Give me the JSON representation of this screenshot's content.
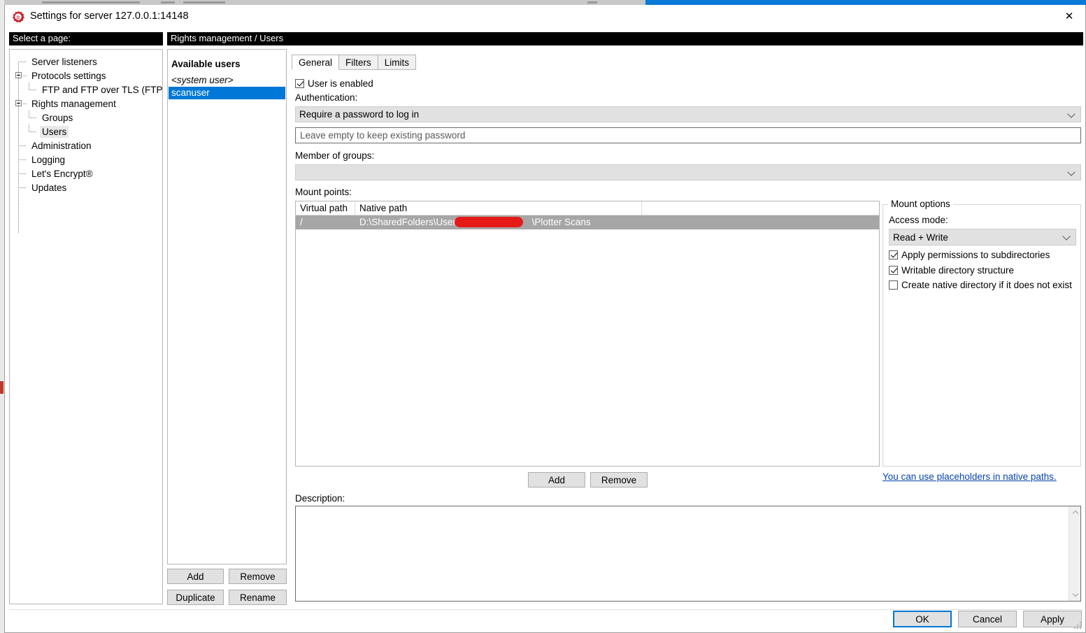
{
  "window": {
    "title": "Settings for server 127.0.0.1:14148",
    "icon": "filezilla-icon",
    "close_label": "✕"
  },
  "left_header": "Select a page:",
  "right_header": "Rights management / Users",
  "tree": {
    "items": [
      {
        "label": "Server listeners",
        "level": 1,
        "expander": false,
        "selected": false
      },
      {
        "label": "Protocols settings",
        "level": 1,
        "expander": true,
        "selected": false
      },
      {
        "label": "FTP and FTP over TLS (FTPS)",
        "level": 2,
        "expander": false,
        "selected": false
      },
      {
        "label": "Rights management",
        "level": 1,
        "expander": true,
        "selected": false
      },
      {
        "label": "Groups",
        "level": 2,
        "expander": false,
        "selected": false
      },
      {
        "label": "Users",
        "level": 2,
        "expander": false,
        "selected": true
      },
      {
        "label": "Administration",
        "level": 1,
        "expander": false,
        "selected": false
      },
      {
        "label": "Logging",
        "level": 1,
        "expander": false,
        "selected": false
      },
      {
        "label": "Let's Encrypt®",
        "level": 1,
        "expander": false,
        "selected": false
      },
      {
        "label": "Updates",
        "level": 1,
        "expander": false,
        "selected": false
      }
    ]
  },
  "users_panel": {
    "title": "Available users",
    "items": [
      {
        "label": "<system user>",
        "system": true,
        "selected": false
      },
      {
        "label": "scanuser",
        "system": false,
        "selected": true
      }
    ],
    "buttons": {
      "add": "Add",
      "remove": "Remove",
      "duplicate": "Duplicate",
      "rename": "Rename"
    }
  },
  "tabs": [
    {
      "label": "General",
      "active": true
    },
    {
      "label": "Filters",
      "active": false
    },
    {
      "label": "Limits",
      "active": false
    }
  ],
  "general": {
    "user_enabled_label": "User is enabled",
    "user_enabled_checked": true,
    "authentication_label": "Authentication:",
    "authentication_value": "Require a password to log in",
    "password_placeholder": "Leave empty to keep existing password",
    "member_of_groups_label": "Member of groups:",
    "member_of_groups_value": "",
    "mount_points_label": "Mount points:",
    "mount_points": {
      "columns": [
        "Virtual path",
        "Native path"
      ],
      "rows": [
        {
          "virtual_path": "/",
          "native_path_prefix": "D:\\SharedFolders\\Users\\",
          "native_path_suffix": "\\Plotter Scans",
          "redacted": true,
          "selected": true
        }
      ]
    },
    "add_label": "Add",
    "remove_label": "Remove",
    "placeholder_link": "You can use placeholders in native paths.",
    "description_label": "Description:",
    "description_value": ""
  },
  "mount_options": {
    "group_title": "Mount options",
    "access_mode_label": "Access mode:",
    "access_mode_value": "Read + Write",
    "checkboxes": [
      {
        "label": "Apply permissions to subdirectories",
        "checked": true
      },
      {
        "label": "Writable directory structure",
        "checked": true
      },
      {
        "label": "Create native directory if it does not exist",
        "checked": false
      }
    ]
  },
  "footer": {
    "ok": "OK",
    "cancel": "Cancel",
    "apply": "Apply"
  },
  "colors": {
    "selection_blue": "#0078d7",
    "redaction_red": "#e51a16",
    "link_blue": "#0645ad",
    "row_selected_gray": "#a6a6a6"
  }
}
